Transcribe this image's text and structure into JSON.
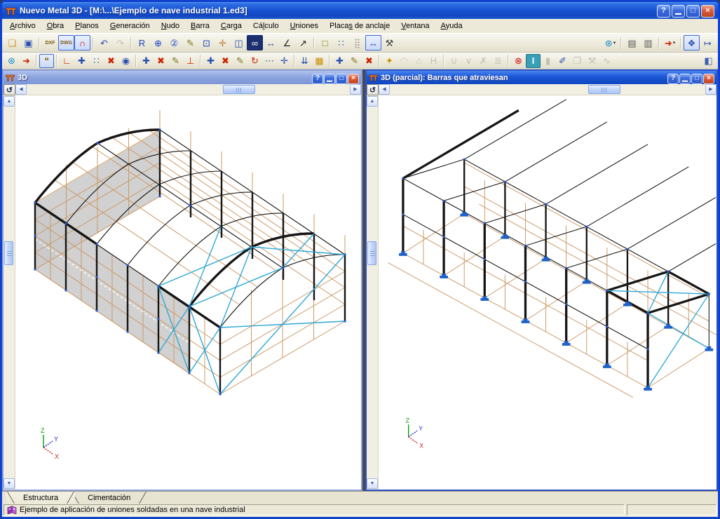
{
  "app": {
    "title": "Nuevo Metal 3D - [M:\\...\\Ejemplo de nave industrial 1.ed3]"
  },
  "window_controls": [
    {
      "name": "help",
      "glyph": "?"
    },
    {
      "name": "minimize",
      "glyph": "▁"
    },
    {
      "name": "maximize",
      "glyph": "□"
    },
    {
      "name": "close",
      "glyph": "×"
    }
  ],
  "menu": [
    {
      "label": "Archivo",
      "accel": 0
    },
    {
      "label": "Obra",
      "accel": 0
    },
    {
      "label": "Planos",
      "accel": 0
    },
    {
      "label": "Generación",
      "accel": 0
    },
    {
      "label": "Nudo",
      "accel": 0
    },
    {
      "label": "Barra",
      "accel": 0
    },
    {
      "label": "Carga",
      "accel": 0
    },
    {
      "label": "Cálculo",
      "accel": 2
    },
    {
      "label": "Uniones",
      "accel": 0
    },
    {
      "label": "Placas de anclaje",
      "accel": 5
    },
    {
      "label": "Ventana",
      "accel": 0
    },
    {
      "label": "Ayuda",
      "accel": 0
    }
  ],
  "toolbar1": {
    "left": [
      [
        {
          "n": "open-file",
          "g": "❏",
          "c": "#D49324"
        },
        {
          "n": "save-file",
          "g": "▣",
          "c": "#2B4FAF"
        }
      ],
      [
        {
          "n": "dxf-dwg-view",
          "g": "DXF",
          "c": "#7A5A18",
          "text": true
        },
        {
          "n": "dxf-dwg-layers",
          "g": "DWG",
          "c": "#7A5A18",
          "text": true,
          "s": "pressed"
        },
        {
          "n": "snap-magnet",
          "g": "∩",
          "c": "#CC1111",
          "s": "pressed"
        }
      ],
      [
        {
          "n": "undo",
          "g": "↶",
          "c": "#2B4FAF"
        },
        {
          "n": "redo",
          "g": "↷",
          "c": "#888888",
          "s": "disabled"
        }
      ],
      [
        {
          "n": "zoom-rotate",
          "g": "R",
          "c": "#1A43C8"
        },
        {
          "n": "zoom-extents",
          "g": "⊕",
          "c": "#1A43C8"
        },
        {
          "n": "zoom-previous",
          "g": "②",
          "c": "#1A43C8"
        },
        {
          "n": "mark-zone",
          "g": "✎",
          "c": "#7A7A22"
        },
        {
          "n": "zoom-window",
          "g": "⊡",
          "c": "#1A43C8"
        },
        {
          "n": "pan-view",
          "g": "✛",
          "c": "#C07830"
        },
        {
          "n": "window-print",
          "g": "◫",
          "c": "#2B4FAF"
        },
        {
          "n": "search-elements",
          "g": "∞",
          "c": "#FFFFFF",
          "s": "dark"
        },
        {
          "n": "measure-distance",
          "g": "↔",
          "c": "#2B4FAF"
        },
        {
          "n": "measure-angle",
          "g": "∠",
          "c": "#222222"
        },
        {
          "n": "measure-coords",
          "g": "↗",
          "c": "#222222"
        }
      ],
      [
        {
          "n": "region-rectangle",
          "g": "□",
          "c": "#7E7E00"
        },
        {
          "n": "region-polygon",
          "g": "∷",
          "c": "#2B4FAF"
        },
        {
          "n": "region-grid",
          "g": "⣿",
          "c": "#999999"
        },
        {
          "n": "dimensions-view",
          "g": "↔",
          "c": "#2B4FAF",
          "s": "pressed"
        },
        {
          "n": "tools-options",
          "g": "⚒",
          "c": "#444444"
        }
      ]
    ],
    "right": [
      [
        {
          "n": "web-services",
          "g": "⊛",
          "c": "#1A8ACC",
          "menu": true
        }
      ],
      [
        {
          "n": "print",
          "g": "▤",
          "c": "#555555"
        },
        {
          "n": "plot",
          "g": "▥",
          "c": "#555555"
        }
      ],
      [
        {
          "n": "export-file",
          "g": "➜",
          "c": "#CC2200",
          "menu": true
        }
      ],
      [
        {
          "n": "window-config",
          "g": "❖",
          "c": "#2B4FAF",
          "s": "pressed"
        },
        {
          "n": "window-switch",
          "g": "↦",
          "c": "#2B4FAF"
        }
      ]
    ]
  },
  "toolbar2": {
    "left": [
      [
        {
          "n": "globe-internet",
          "g": "⊛",
          "c": "#1A8ACC"
        },
        {
          "n": "export-to-disk",
          "g": "➜",
          "c": "#CC2200"
        }
      ],
      [
        {
          "n": "comment-note",
          "g": "❝",
          "c": "#8A7A30",
          "s": "pressed"
        }
      ],
      [
        {
          "n": "origin-axes",
          "g": "∟",
          "c": "#CC2200"
        },
        {
          "n": "dimension-add",
          "g": "✚",
          "c": "#2B4FAF"
        },
        {
          "n": "selection-dotted",
          "g": "∷",
          "c": "#2B4FAF"
        },
        {
          "n": "selection-delete",
          "g": "✖",
          "c": "#CC2200"
        },
        {
          "n": "visibility-eye",
          "g": "◉",
          "c": "#2B4FAF"
        }
      ],
      [
        {
          "n": "node-new",
          "g": "✚",
          "c": "#2B4FAF"
        },
        {
          "n": "node-delete",
          "g": "✖",
          "c": "#CC2200"
        },
        {
          "n": "node-edit",
          "g": "✎",
          "c": "#7A7A22"
        },
        {
          "n": "node-support",
          "g": "⊥",
          "c": "#CC2200"
        }
      ],
      [
        {
          "n": "bar-new",
          "g": "✚",
          "c": "#2B4FAF"
        },
        {
          "n": "bar-delete",
          "g": "✖",
          "c": "#CC2200"
        },
        {
          "n": "bar-edit",
          "g": "✎",
          "c": "#7A7A22"
        },
        {
          "n": "bar-rotate",
          "g": "↻",
          "c": "#CC2200"
        },
        {
          "n": "bar-divide",
          "g": "⋯",
          "c": "#2B4FAF"
        },
        {
          "n": "bar-insert-node",
          "g": "✛",
          "c": "#2B4FAF"
        }
      ],
      [
        {
          "n": "loads-introduce",
          "g": "⇊",
          "c": "#2B4FAF"
        },
        {
          "n": "loads-dumper",
          "g": "▦",
          "c": "#C89000"
        }
      ],
      [
        {
          "n": "load-new",
          "g": "✚",
          "c": "#2B4FAF"
        },
        {
          "n": "load-edit",
          "g": "✎",
          "c": "#7A7A22"
        },
        {
          "n": "load-delete",
          "g": "✖",
          "c": "#CC2200"
        }
      ],
      [
        {
          "n": "union-wand",
          "g": "✦",
          "c": "#C89000"
        },
        {
          "n": "union-arc",
          "g": "◠",
          "c": "#888888",
          "s": "disabled"
        },
        {
          "n": "union-gable",
          "g": "⌂",
          "c": "#888888",
          "s": "disabled"
        },
        {
          "n": "profile-h",
          "g": "H",
          "c": "#888888",
          "s": "disabled"
        }
      ],
      [
        {
          "n": "truss-down",
          "g": "∪",
          "c": "#888888",
          "s": "disabled"
        },
        {
          "n": "truss-up",
          "g": "∨",
          "c": "#888888",
          "s": "disabled"
        },
        {
          "n": "bars-verify",
          "g": "✗",
          "c": "#888888",
          "s": "disabled"
        },
        {
          "n": "bars-report",
          "g": "≣",
          "c": "#888888",
          "s": "disabled"
        }
      ],
      [
        {
          "n": "cancel-process",
          "g": "⊗",
          "c": "#CC1111"
        },
        {
          "n": "beam-describe",
          "g": "I",
          "c": "#FFFFFF",
          "s": "teal"
        },
        {
          "n": "beam-copy",
          "g": "▮",
          "c": "#888888",
          "s": "disabled"
        },
        {
          "n": "beam-edit",
          "g": "✐",
          "c": "#2B4FAF"
        },
        {
          "n": "block-copy",
          "g": "❒",
          "c": "#888888",
          "s": "disabled"
        },
        {
          "n": "block-tools",
          "g": "⚒",
          "c": "#888888",
          "s": "disabled"
        },
        {
          "n": "connection-plug",
          "g": "∿",
          "c": "#888888",
          "s": "disabled"
        }
      ]
    ],
    "right": [
      [
        {
          "n": "export-calculation",
          "g": "◧",
          "c": "#3A5FAF"
        }
      ]
    ]
  },
  "windows": {
    "left": {
      "title": "3D",
      "active": false
    },
    "right": {
      "title": "3D (parcial): Barras que atraviesan",
      "active": true
    }
  },
  "scrollbar": {
    "left_arrow": "◀",
    "right_arrow": "▶",
    "up_arrow": "▲",
    "down_arrow": "▼",
    "rotate": "↺"
  },
  "axes": {
    "x": "X",
    "y": "Y",
    "z": "Z"
  },
  "tabs": [
    {
      "label": "Estructura",
      "active": true
    },
    {
      "label": "Cimentación",
      "active": false
    }
  ],
  "statusbar": {
    "message": "Ejemplo de aplicación de uniones soldadas en una nave industrial",
    "right_panel": ""
  },
  "colors": {
    "grid": "#CC9966",
    "frame": "#151515",
    "bracing": "#2FA8D8",
    "node": "#2255CC",
    "wall_fill": "#C9C9C9",
    "support": "#1E62C8",
    "titlebar_active": "#1A55D4",
    "titlebar_inactive": "#8BA2DC",
    "ui_face": "#ECE9D8"
  }
}
